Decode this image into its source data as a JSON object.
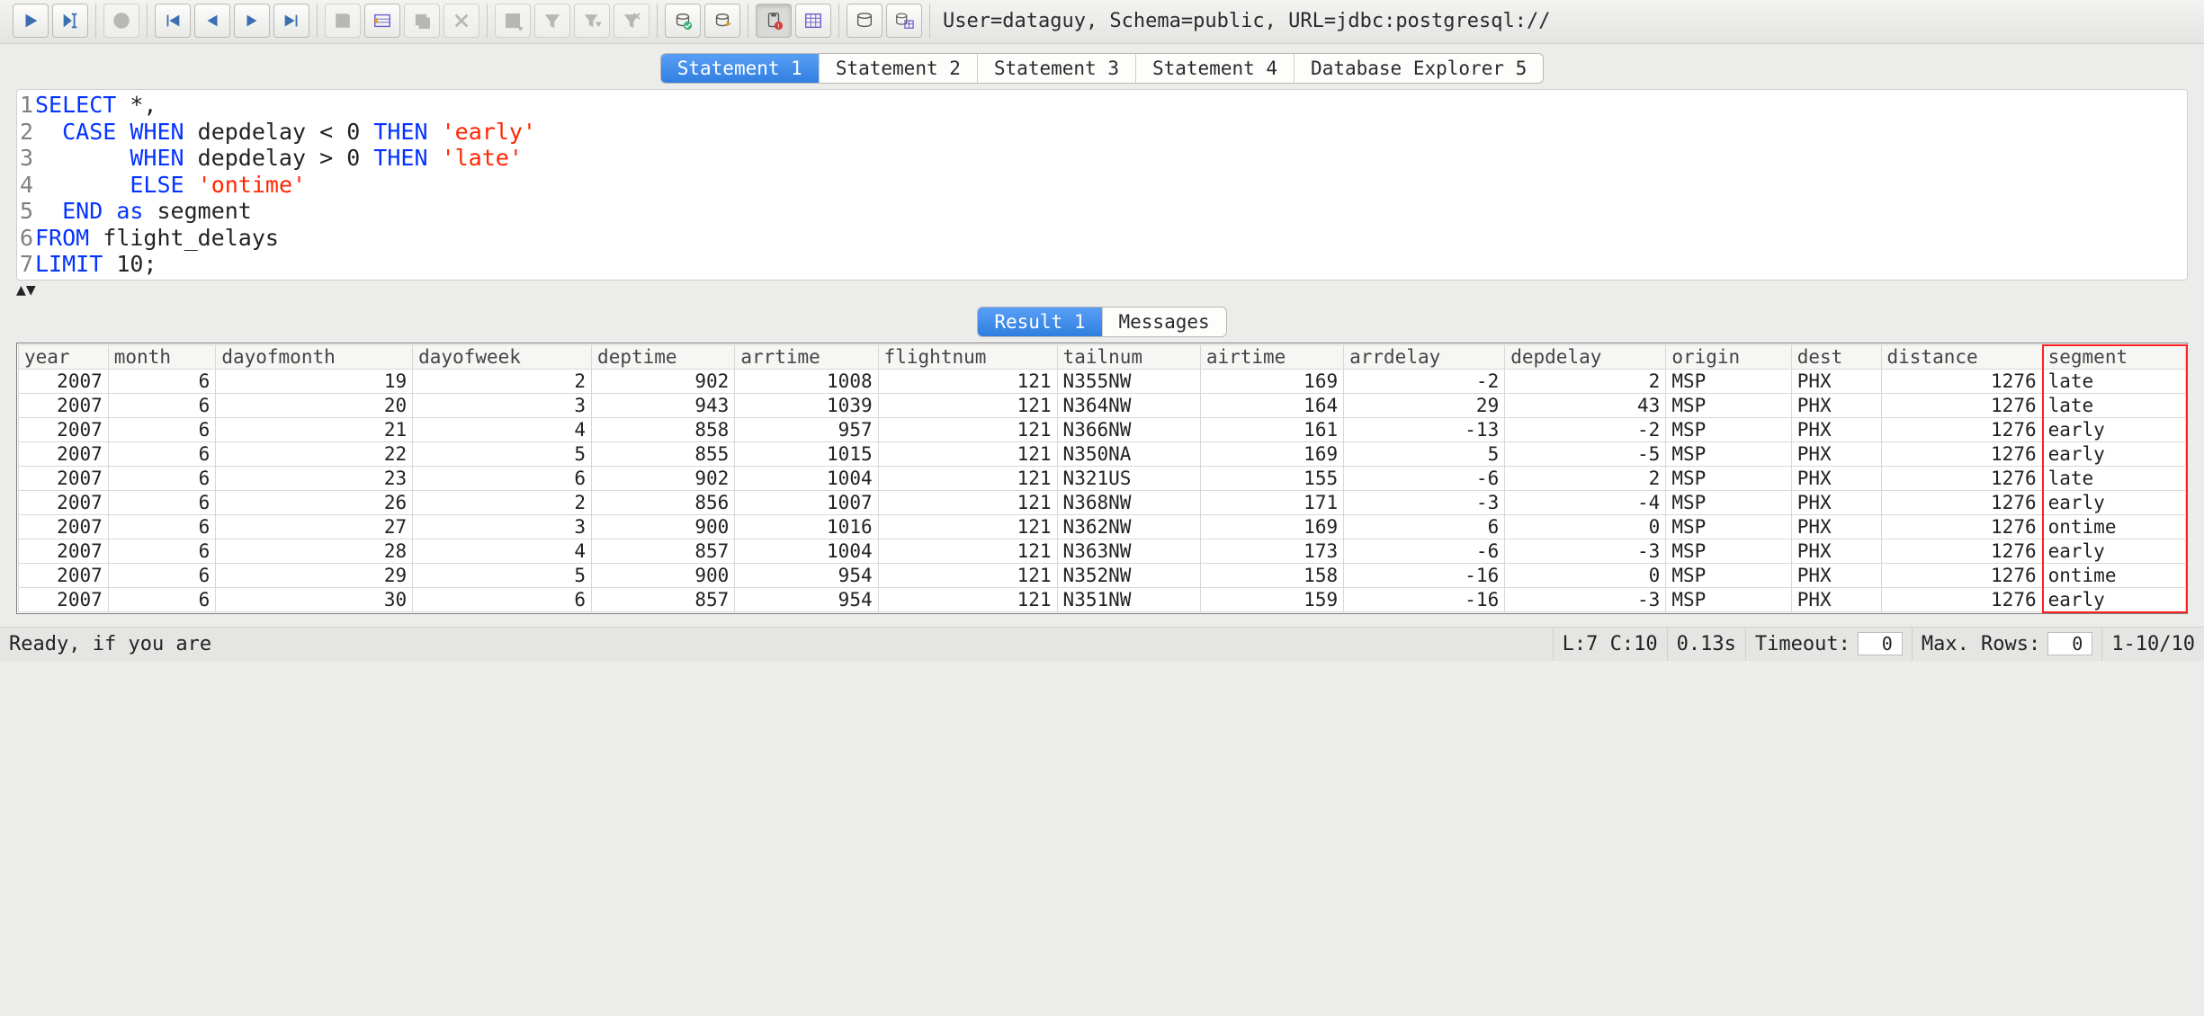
{
  "connection_info": "User=dataguy, Schema=public, URL=jdbc:postgresql://",
  "statement_tabs": [
    "Statement 1",
    "Statement 2",
    "Statement 3",
    "Statement 4",
    "Database Explorer 5"
  ],
  "active_statement_tab": 0,
  "sql_lines": [
    {
      "n": "1",
      "tokens": [
        {
          "t": "SELECT",
          "c": "kw"
        },
        {
          "t": " *,",
          "c": ""
        }
      ]
    },
    {
      "n": "2",
      "tokens": [
        {
          "t": "  ",
          "c": ""
        },
        {
          "t": "CASE",
          "c": "kw"
        },
        {
          "t": " ",
          "c": ""
        },
        {
          "t": "WHEN",
          "c": "kw"
        },
        {
          "t": " depdelay < 0 ",
          "c": ""
        },
        {
          "t": "THEN",
          "c": "kw"
        },
        {
          "t": " ",
          "c": ""
        },
        {
          "t": "'early'",
          "c": "str"
        }
      ]
    },
    {
      "n": "3",
      "tokens": [
        {
          "t": "       ",
          "c": ""
        },
        {
          "t": "WHEN",
          "c": "kw"
        },
        {
          "t": " depdelay > 0 ",
          "c": ""
        },
        {
          "t": "THEN",
          "c": "kw"
        },
        {
          "t": " ",
          "c": ""
        },
        {
          "t": "'late'",
          "c": "str"
        }
      ]
    },
    {
      "n": "4",
      "tokens": [
        {
          "t": "       ",
          "c": ""
        },
        {
          "t": "ELSE",
          "c": "kw"
        },
        {
          "t": " ",
          "c": ""
        },
        {
          "t": "'ontime'",
          "c": "str"
        }
      ]
    },
    {
      "n": "5",
      "tokens": [
        {
          "t": "  ",
          "c": ""
        },
        {
          "t": "END",
          "c": "kw"
        },
        {
          "t": " ",
          "c": ""
        },
        {
          "t": "as",
          "c": "kw"
        },
        {
          "t": " segment",
          "c": ""
        }
      ]
    },
    {
      "n": "6",
      "tokens": [
        {
          "t": "FROM",
          "c": "kw"
        },
        {
          "t": " flight_delays",
          "c": ""
        }
      ]
    },
    {
      "n": "7",
      "tokens": [
        {
          "t": "LIMIT",
          "c": "kw"
        },
        {
          "t": " 10;",
          "c": ""
        }
      ]
    }
  ],
  "result_tabs": [
    "Result 1",
    "Messages"
  ],
  "active_result_tab": 0,
  "columns": [
    {
      "name": "year",
      "align": "num"
    },
    {
      "name": "month",
      "align": "num"
    },
    {
      "name": "dayofmonth",
      "align": "num"
    },
    {
      "name": "dayofweek",
      "align": "num"
    },
    {
      "name": "deptime",
      "align": "num"
    },
    {
      "name": "arrtime",
      "align": "num"
    },
    {
      "name": "flightnum",
      "align": "num"
    },
    {
      "name": "tailnum",
      "align": "txt"
    },
    {
      "name": "airtime",
      "align": "num"
    },
    {
      "name": "arrdelay",
      "align": "num"
    },
    {
      "name": "depdelay",
      "align": "num"
    },
    {
      "name": "origin",
      "align": "txt"
    },
    {
      "name": "dest",
      "align": "txt"
    },
    {
      "name": "distance",
      "align": "num"
    },
    {
      "name": "segment",
      "align": "txt"
    }
  ],
  "rows": [
    [
      "2007",
      "6",
      "19",
      "2",
      "902",
      "1008",
      "121",
      "N355NW",
      "169",
      "-2",
      "2",
      "MSP",
      "PHX",
      "1276",
      "late"
    ],
    [
      "2007",
      "6",
      "20",
      "3",
      "943",
      "1039",
      "121",
      "N364NW",
      "164",
      "29",
      "43",
      "MSP",
      "PHX",
      "1276",
      "late"
    ],
    [
      "2007",
      "6",
      "21",
      "4",
      "858",
      "957",
      "121",
      "N366NW",
      "161",
      "-13",
      "-2",
      "MSP",
      "PHX",
      "1276",
      "early"
    ],
    [
      "2007",
      "6",
      "22",
      "5",
      "855",
      "1015",
      "121",
      "N350NA",
      "169",
      "5",
      "-5",
      "MSP",
      "PHX",
      "1276",
      "early"
    ],
    [
      "2007",
      "6",
      "23",
      "6",
      "902",
      "1004",
      "121",
      "N321US",
      "155",
      "-6",
      "2",
      "MSP",
      "PHX",
      "1276",
      "late"
    ],
    [
      "2007",
      "6",
      "26",
      "2",
      "856",
      "1007",
      "121",
      "N368NW",
      "171",
      "-3",
      "-4",
      "MSP",
      "PHX",
      "1276",
      "early"
    ],
    [
      "2007",
      "6",
      "27",
      "3",
      "900",
      "1016",
      "121",
      "N362NW",
      "169",
      "6",
      "0",
      "MSP",
      "PHX",
      "1276",
      "ontime"
    ],
    [
      "2007",
      "6",
      "28",
      "4",
      "857",
      "1004",
      "121",
      "N363NW",
      "173",
      "-6",
      "-3",
      "MSP",
      "PHX",
      "1276",
      "early"
    ],
    [
      "2007",
      "6",
      "29",
      "5",
      "900",
      "954",
      "121",
      "N352NW",
      "158",
      "-16",
      "0",
      "MSP",
      "PHX",
      "1276",
      "ontime"
    ],
    [
      "2007",
      "6",
      "30",
      "6",
      "857",
      "954",
      "121",
      "N351NW",
      "159",
      "-16",
      "-3",
      "MSP",
      "PHX",
      "1276",
      "early"
    ]
  ],
  "highlight_column_index": 14,
  "status": {
    "message": "Ready, if you are",
    "cursor": "L:7 C:10",
    "exec_time": "0.13s",
    "timeout_label": "Timeout:",
    "timeout_value": "0",
    "maxrows_label": "Max. Rows:",
    "maxrows_value": "0",
    "range": "1-10/10"
  }
}
